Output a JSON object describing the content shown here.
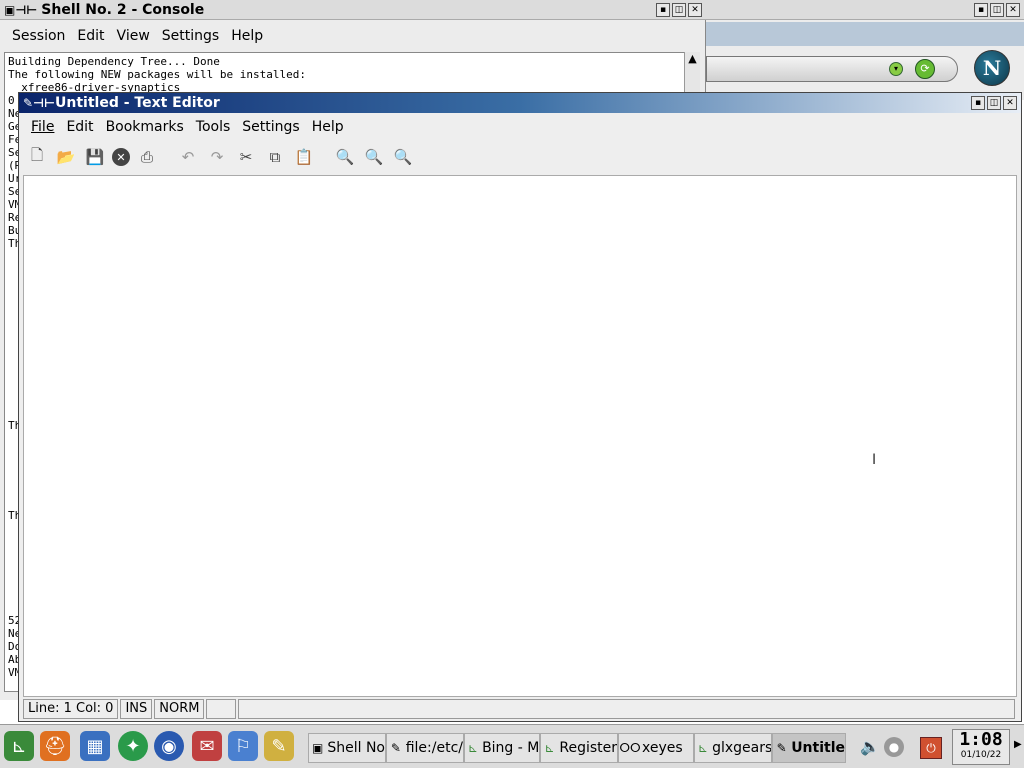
{
  "console": {
    "title": "Shell No. 2 - Console",
    "menu": [
      "Session",
      "Edit",
      "View",
      "Settings",
      "Help"
    ],
    "lines": [
      "Building Dependency Tree... Done",
      "The following NEW packages will be installed:",
      "  xfree86-driver-synaptics"
    ],
    "left_fragments": [
      "0",
      "Ne",
      "Ge",
      "Fe",
      "Se",
      "(R",
      "Ur",
      "Se",
      "VM",
      "Re",
      "Bu",
      "Th"
    ],
    "left_fragments_mid": [
      "Th"
    ],
    "left_fragments_mid2": [
      "Th"
    ],
    "left_fragments_bottom": [
      "52",
      "Ne",
      "Do",
      "Ab",
      "VM"
    ]
  },
  "browser": {
    "logo_letter": "N"
  },
  "editor": {
    "title": "Untitled - Text Editor",
    "menu": [
      "File",
      "Edit",
      "Bookmarks",
      "Tools",
      "Settings",
      "Help"
    ],
    "toolbar_icons": [
      "new-file-icon",
      "open-folder-icon",
      "save-icon",
      "close-icon",
      "print-icon",
      "undo-icon",
      "redo-icon",
      "cut-icon",
      "copy-icon",
      "paste-icon",
      "find-icon",
      "zoom-in-icon",
      "zoom-out-icon"
    ],
    "status": {
      "position": "Line: 1 Col: 0",
      "insert_mode": "INS",
      "selection_mode": "NORM",
      "extra": ""
    }
  },
  "taskbar": {
    "tasks": [
      {
        "label": "Shell No",
        "icon": "terminal-icon"
      },
      {
        "label": "file:/etc/",
        "icon": "pencil-icon"
      },
      {
        "label": "Bing - M",
        "icon": "browser-icon"
      },
      {
        "label": "Register",
        "icon": "browser-icon"
      },
      {
        "label": "xeyes",
        "icon": "eyes-icon"
      },
      {
        "label": "glxgears",
        "icon": "browser-icon"
      },
      {
        "label": "Untitle",
        "icon": "pencil-icon"
      }
    ],
    "clock_time": "1:08",
    "clock_date": "01/10/22"
  }
}
